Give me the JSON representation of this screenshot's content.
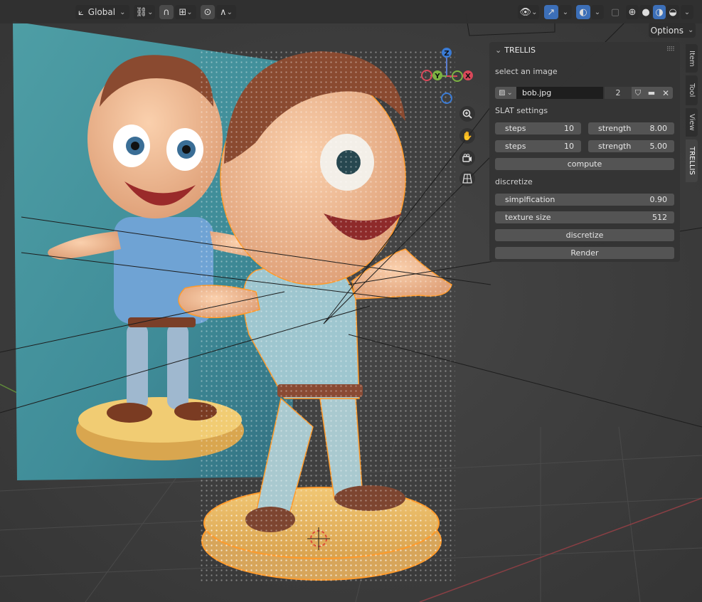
{
  "header": {
    "orientation_label": "Global",
    "options_label": "Options"
  },
  "panel": {
    "title": "TRELLIS",
    "select_image_label": "select an image",
    "image_name": "bob.jpg",
    "image_users": "2",
    "slat_settings_label": "SLAT settings",
    "rows": [
      {
        "steps_label": "steps",
        "steps_value": "10",
        "strength_label": "strength",
        "strength_value": "8.00"
      },
      {
        "steps_label": "steps",
        "steps_value": "10",
        "strength_label": "strength",
        "strength_value": "5.00"
      }
    ],
    "compute_label": "compute",
    "discretize_section_label": "discretize",
    "simplification_label": "simplfication",
    "simplification_value": "0.90",
    "texture_size_label": "texture size",
    "texture_size_value": "512",
    "discretize_button_label": "discretize",
    "render_button_label": "Render"
  },
  "tabs": [
    "Item",
    "Tool",
    "View",
    "TRELLIS"
  ],
  "gizmo": {
    "x": "X",
    "y": "Y",
    "z": "Z"
  }
}
